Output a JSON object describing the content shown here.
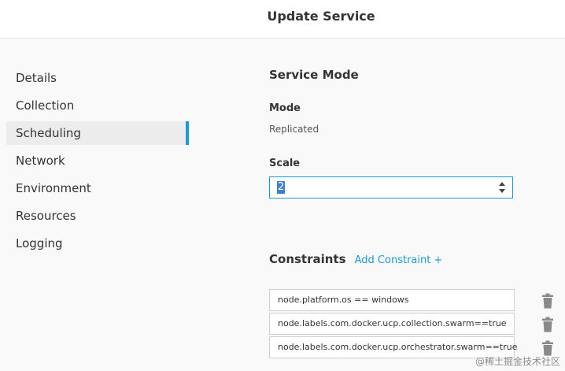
{
  "header": {
    "title": "Update Service"
  },
  "sidebar": {
    "items": [
      {
        "label": "Details"
      },
      {
        "label": "Collection"
      },
      {
        "label": "Scheduling"
      },
      {
        "label": "Network"
      },
      {
        "label": "Environment"
      },
      {
        "label": "Resources"
      },
      {
        "label": "Logging"
      }
    ],
    "active": "Scheduling"
  },
  "service_mode": {
    "title": "Service Mode",
    "mode_label": "Mode",
    "mode_value": "Replicated",
    "scale_label": "Scale",
    "scale_value": "2"
  },
  "constraints": {
    "title": "Constraints",
    "add_label": "Add Constraint +",
    "items": [
      "node.platform.os == windows",
      "node.labels.com.docker.ucp.collection.swarm==true",
      "node.labels.com.docker.ucp.orchestrator.swarm==true"
    ]
  },
  "watermark": "@稀土掘金技术社区",
  "colors": {
    "accent": "#1b9ad6",
    "active_bg": "#ececec",
    "trash_icon": "#8a8a8a"
  },
  "icons": [
    "trash-icon",
    "spinner-up-icon",
    "spinner-down-icon"
  ]
}
